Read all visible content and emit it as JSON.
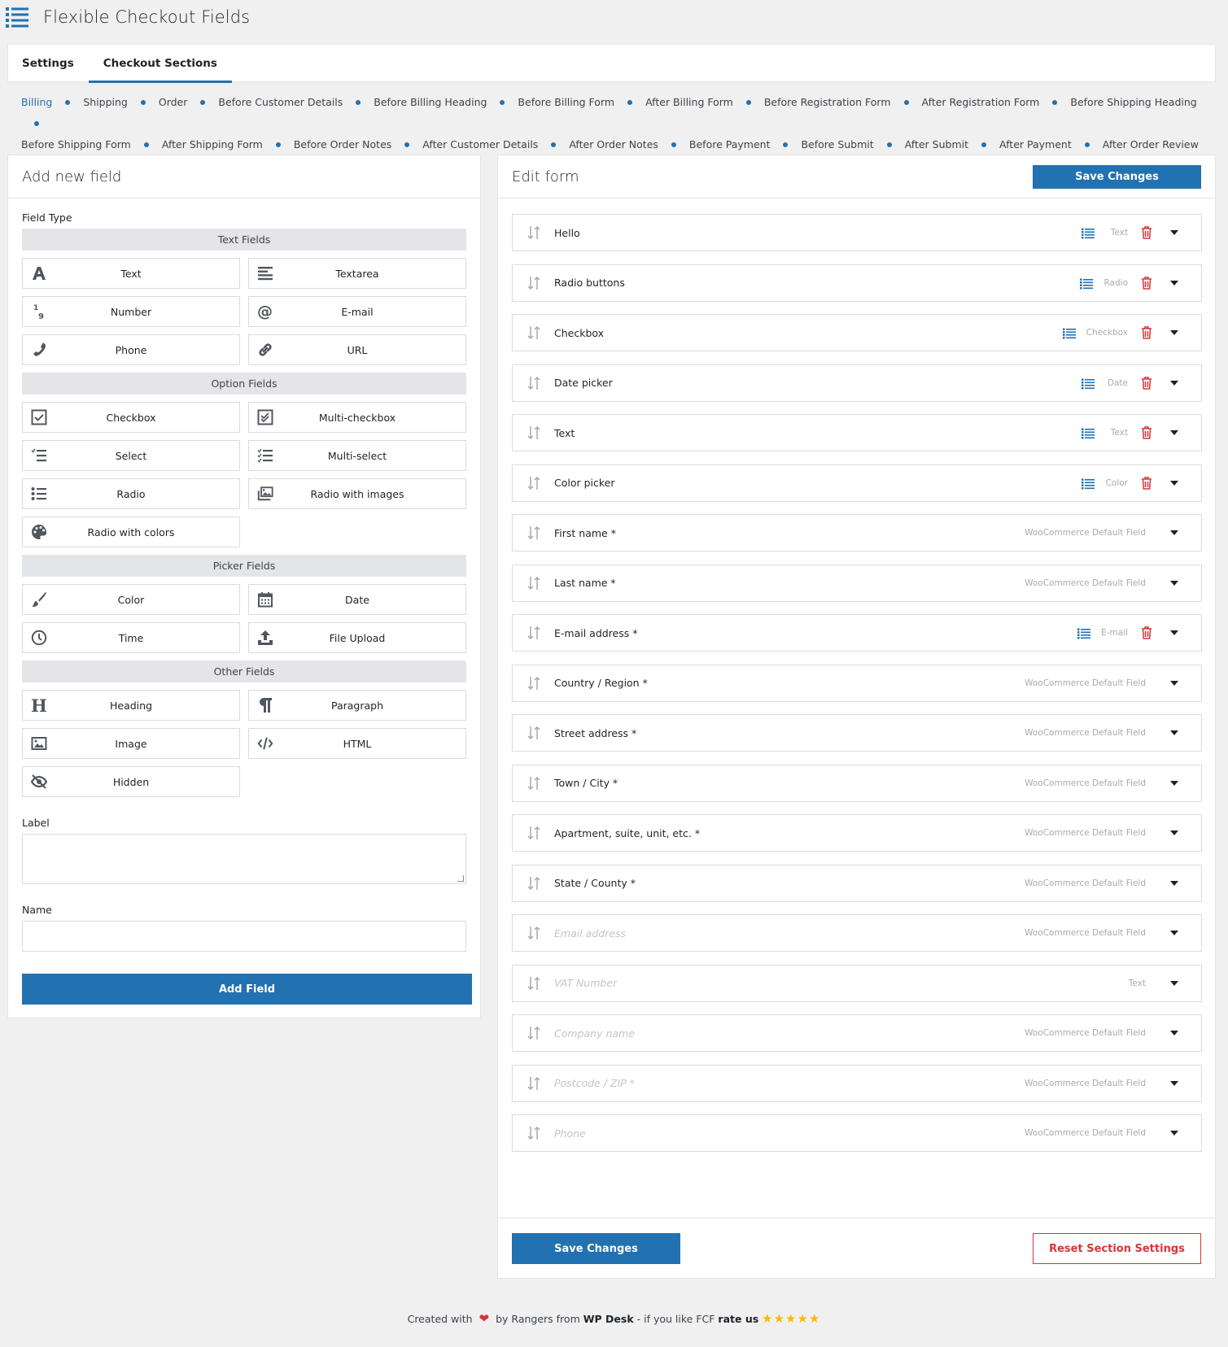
{
  "app": {
    "title": "Flexible Checkout Fields",
    "logo_icon": "list-icon"
  },
  "tabs": [
    {
      "label": "Settings",
      "active": false
    },
    {
      "label": "Checkout Sections",
      "active": true
    }
  ],
  "sections": [
    {
      "label": "Billing",
      "active": true
    },
    {
      "label": "Shipping"
    },
    {
      "label": "Order"
    },
    {
      "label": "Before Customer Details"
    },
    {
      "label": "Before Billing Heading"
    },
    {
      "label": "Before Billing Form"
    },
    {
      "label": "After Billing Form"
    },
    {
      "label": "Before Registration Form"
    },
    {
      "label": "After Registration Form"
    },
    {
      "label": "Before Shipping Heading"
    },
    {
      "label": "Before Shipping Form"
    },
    {
      "label": "After Shipping Form"
    },
    {
      "label": "Before Order Notes"
    },
    {
      "label": "After Customer Details"
    },
    {
      "label": "After Order Notes"
    },
    {
      "label": "Before Payment"
    },
    {
      "label": "Before Submit"
    },
    {
      "label": "After Submit"
    },
    {
      "label": "After Payment"
    },
    {
      "label": "After Order Review"
    }
  ],
  "add_field": {
    "title": "Add new field",
    "field_type_label": "Field Type",
    "groups": [
      {
        "title": "Text Fields",
        "items": [
          {
            "label": "Text",
            "icon": "text-icon"
          },
          {
            "label": "Textarea",
            "icon": "textarea-icon"
          },
          {
            "label": "Number",
            "icon": "number-icon"
          },
          {
            "label": "E-mail",
            "icon": "at-icon"
          },
          {
            "label": "Phone",
            "icon": "phone-icon"
          },
          {
            "label": "URL",
            "icon": "link-icon"
          }
        ]
      },
      {
        "title": "Option Fields",
        "items": [
          {
            "label": "Checkbox",
            "icon": "checkbox-icon"
          },
          {
            "label": "Multi-checkbox",
            "icon": "multi-checkbox-icon"
          },
          {
            "label": "Select",
            "icon": "select-icon"
          },
          {
            "label": "Multi-select",
            "icon": "multi-select-icon"
          },
          {
            "label": "Radio",
            "icon": "radio-list-icon"
          },
          {
            "label": "Radio with images",
            "icon": "images-icon"
          },
          {
            "label": "Radio with colors",
            "icon": "palette-icon"
          }
        ]
      },
      {
        "title": "Picker Fields",
        "items": [
          {
            "label": "Color",
            "icon": "brush-icon"
          },
          {
            "label": "Date",
            "icon": "calendar-icon"
          },
          {
            "label": "Time",
            "icon": "clock-icon"
          },
          {
            "label": "File Upload",
            "icon": "upload-icon"
          }
        ]
      },
      {
        "title": "Other Fields",
        "items": [
          {
            "label": "Heading",
            "icon": "heading-icon"
          },
          {
            "label": "Paragraph",
            "icon": "paragraph-icon"
          },
          {
            "label": "Image",
            "icon": "image-icon"
          },
          {
            "label": "HTML",
            "icon": "code-icon"
          },
          {
            "label": "Hidden",
            "icon": "eye-slash-icon"
          }
        ]
      }
    ],
    "label_field": {
      "label": "Label",
      "value": ""
    },
    "name_field": {
      "label": "Name",
      "value": ""
    },
    "submit_label": "Add Field"
  },
  "edit_form": {
    "title": "Edit form",
    "save_label": "Save Changes",
    "reset_label": "Reset Section Settings",
    "rows": [
      {
        "name": "Hello",
        "type": "Text",
        "custom": true,
        "enabled": true
      },
      {
        "name": "Radio buttons",
        "type": "Radio",
        "custom": true,
        "enabled": true
      },
      {
        "name": "Checkbox",
        "type": "Checkbox",
        "custom": true,
        "enabled": true
      },
      {
        "name": "Date picker",
        "type": "Date",
        "custom": true,
        "enabled": true
      },
      {
        "name": "Text",
        "type": "Text",
        "custom": true,
        "enabled": true
      },
      {
        "name": "Color picker",
        "type": "Color",
        "custom": true,
        "enabled": true
      },
      {
        "name": "First name *",
        "type": "WooCommerce Default Field",
        "custom": false,
        "enabled": true
      },
      {
        "name": "Last name *",
        "type": "WooCommerce Default Field",
        "custom": false,
        "enabled": true
      },
      {
        "name": "E-mail address *",
        "type": "E-mail",
        "custom": true,
        "enabled": true
      },
      {
        "name": "Country / Region *",
        "type": "WooCommerce Default Field",
        "custom": false,
        "enabled": true
      },
      {
        "name": "Street address *",
        "type": "WooCommerce Default Field",
        "custom": false,
        "enabled": true
      },
      {
        "name": "Town / City *",
        "type": "WooCommerce Default Field",
        "custom": false,
        "enabled": true
      },
      {
        "name": "Apartment, suite, unit, etc. *",
        "type": "WooCommerce Default Field",
        "custom": false,
        "enabled": true
      },
      {
        "name": "State / County *",
        "type": "WooCommerce Default Field",
        "custom": false,
        "enabled": true
      },
      {
        "name": "Email address",
        "type": "WooCommerce Default Field",
        "custom": false,
        "enabled": false
      },
      {
        "name": "VAT Number",
        "type": "Text",
        "custom": false,
        "enabled": false
      },
      {
        "name": "Company name",
        "type": "WooCommerce Default Field",
        "custom": false,
        "enabled": false
      },
      {
        "name": "Postcode / ZIP *",
        "type": "WooCommerce Default Field",
        "custom": false,
        "enabled": false
      },
      {
        "name": "Phone",
        "type": "WooCommerce Default Field",
        "custom": false,
        "enabled": false
      }
    ]
  },
  "footer": {
    "created_with": "Created with",
    "by": "by Rangers from",
    "company": "WP Desk",
    "if_you_like": "- if you like FCF",
    "rate_us": "rate us",
    "stars": "★★★★★"
  },
  "colors": {
    "accent": "#2271b1",
    "danger": "#d63638",
    "star": "#ffb900"
  }
}
